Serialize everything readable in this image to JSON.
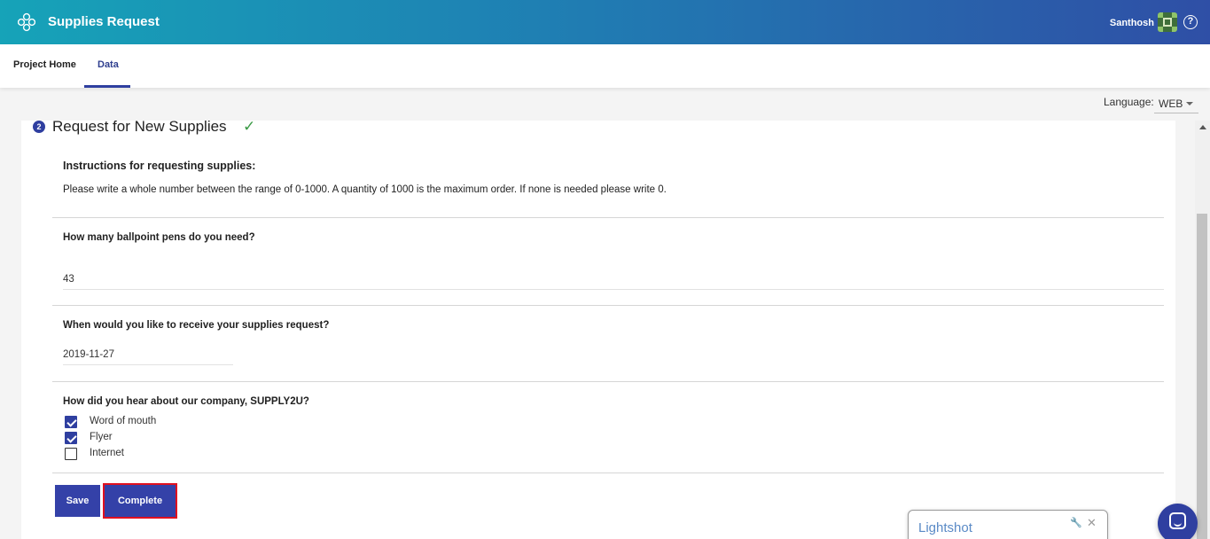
{
  "app": {
    "title": "Supplies Request",
    "user_name": "Santhosh",
    "help_label": "?"
  },
  "nav": {
    "tabs": [
      {
        "label": "Project Home",
        "active": false
      },
      {
        "label": "Data",
        "active": true
      }
    ]
  },
  "language": {
    "label": "Language:",
    "value": "WEB"
  },
  "section": {
    "step": "2",
    "title": "Request for New Supplies",
    "status_icon": "check-icon"
  },
  "instructions": {
    "title": "Instructions for requesting supplies:",
    "text": "Please write a whole number between the range of 0-1000. A quantity of 1000 is the maximum order. If none is needed please write 0."
  },
  "questions": [
    {
      "label": "How many ballpoint pens do you need?",
      "value": "43"
    },
    {
      "label": "When would you like to receive your supplies request?",
      "value": "2019-11-27"
    },
    {
      "label": "How did you hear about our company, SUPPLY2U?",
      "options": [
        {
          "label": "Word of mouth",
          "checked": true
        },
        {
          "label": "Flyer",
          "checked": true
        },
        {
          "label": "Internet",
          "checked": false
        }
      ]
    }
  ],
  "buttons": {
    "save": "Save",
    "complete": "Complete"
  },
  "lightshot": {
    "title": "Lightshot"
  },
  "colors": {
    "header_start": "#16a3b8",
    "header_end": "#2f4fa6",
    "primary": "#3441a8",
    "highlight_outline": "#e01020",
    "success": "#3a9a45"
  }
}
